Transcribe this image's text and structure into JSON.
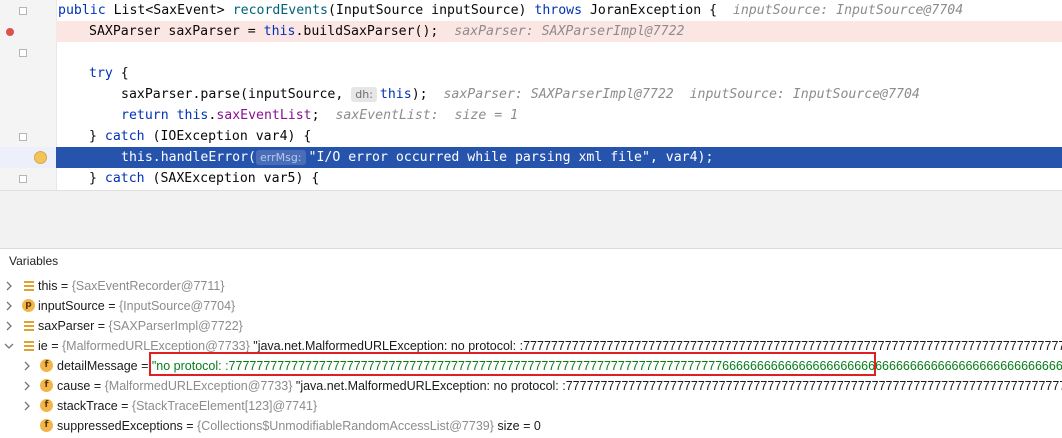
{
  "editor": {
    "lines": [
      {
        "kw1": "public",
        "t1": " List<SaxEvent> ",
        "fn": "recordEvents",
        "t2": "(InputSource inputSource) ",
        "kw2": "throws",
        "t3": " JoranException {",
        "hint": "inputSource: InputSource@7704"
      },
      {
        "t1": "SAXParser saxParser = ",
        "kw": "this",
        "t2": ".buildSaxParser();",
        "hint": "saxParser: SAXParserImpl@7722"
      },
      {
        "text": ""
      },
      {
        "kw": "try",
        "t1": " {"
      },
      {
        "t1": "saxParser.parse(inputSource, ",
        "inlay": "dh:",
        "kw": "this",
        "t2": ");",
        "hint": "saxParser: SAXParserImpl@7722  inputSource: InputSource@7704"
      },
      {
        "kw1": "return",
        "t1": " ",
        "kw2": "this",
        "t2": ".",
        "fld": "saxEventList",
        "t3": ";",
        "hint": "saxEventList:  size = 1"
      },
      {
        "t1": "} ",
        "kw": "catch",
        "t2": " (IOException var4) {"
      },
      {
        "t1": "this.handleError(",
        "inlay": "errMsg:",
        "str": "\"I/O error occurred while parsing xml file\"",
        "t2": ", var4);"
      },
      {
        "t1": "} ",
        "kw": "catch",
        "t2": " (SAXException var5) {"
      }
    ]
  },
  "variables": {
    "title": "Variables",
    "items": [
      {
        "name": "this",
        "eq": " = ",
        "type": "{SaxEventRecorder@7711}",
        "value": "",
        "icon": "list-icon"
      },
      {
        "name": "inputSource",
        "eq": " = ",
        "type": "{InputSource@7704}",
        "value": "",
        "icon": "parameter-icon",
        "icon_letter": "p"
      },
      {
        "name": "saxParser",
        "eq": " = ",
        "type": "{SAXParserImpl@7722}",
        "value": "",
        "icon": "list-icon"
      },
      {
        "name": "ie",
        "eq": " = ",
        "type": "{MalformedURLException@7733}",
        "value": " \"java.net.MalformedURLException: no protocol: :777777777777777777777777777777777777777777777777777777777777777777777777777777777777777777777777777777777777777",
        "icon": "list-icon"
      },
      {
        "name": "detailMessage",
        "eq": " = ",
        "type": "",
        "value": "\"no protocol: :7777777777777777777777777777777777777777777777777777777777777777777777766666666666666666666666666666666666666666666666666666666666",
        "icon": "field-icon",
        "icon_letter": "f"
      },
      {
        "name": "cause",
        "eq": " = ",
        "type": "{MalformedURLException@7733}",
        "value": " \"java.net.MalformedURLException: no protocol: :777777777777777777777777777777777777777777777777777777777777777777777777777777777777777777",
        "icon": "field-icon",
        "icon_letter": "f"
      },
      {
        "name": "stackTrace",
        "eq": " = ",
        "type": "{StackTraceElement[123]@7741}",
        "value": "",
        "icon": "field-icon",
        "icon_letter": "f"
      },
      {
        "name": "suppressedExceptions",
        "eq": " = ",
        "type": "{Collections$UnmodifiableRandomAccessList@7739}",
        "value": "  size = 0",
        "icon": "field-icon",
        "icon_letter": "f"
      }
    ]
  },
  "colors": {
    "highlight": "#2653ac",
    "string": "#067d17",
    "keyword": "#0033b3",
    "annotation_box": "#e02020"
  }
}
